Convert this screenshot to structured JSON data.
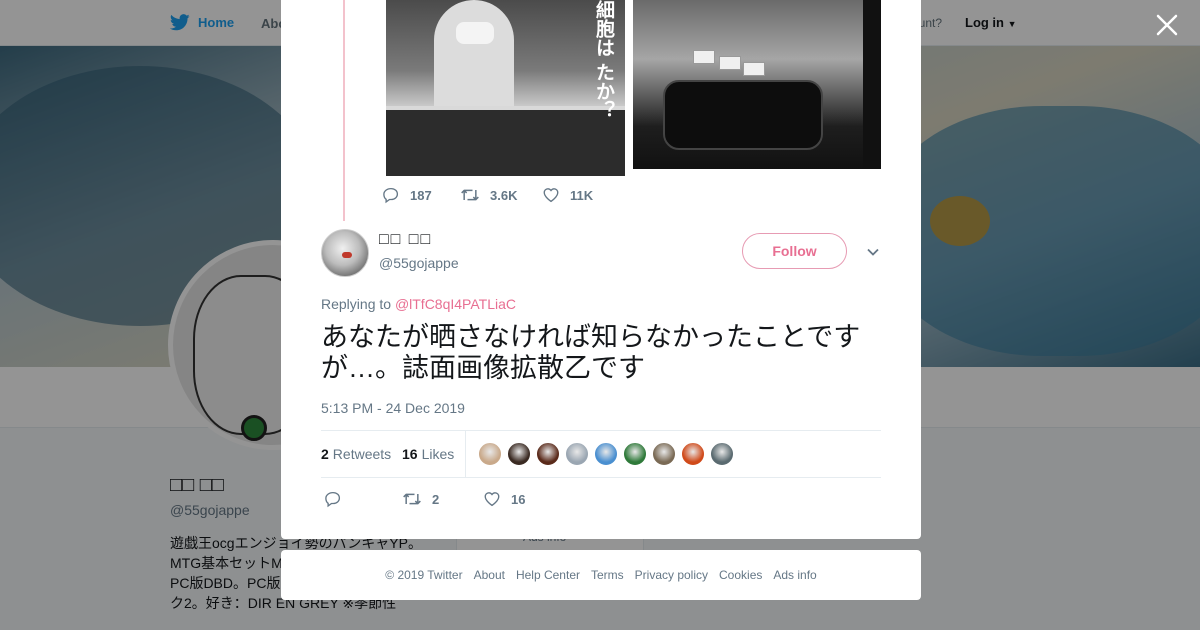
{
  "background_page": {
    "nav": {
      "home_label": "Home",
      "about_label": "Abo",
      "account_prompt": "ccount?",
      "login_label": "Log in"
    },
    "profile": {
      "name": "□□ □□",
      "handle": "@55gojappe",
      "bio": "遊戯王ocgエンジョイ勢のパンキャYP。MTG基本セットM ださい。Steamと い！PC版DBD。PC版+Switch版オーバー クック2。好き：DIR EN GREY ※季節性",
      "ads_info": "Ads info"
    }
  },
  "modal": {
    "parent_tweet": {
      "image_text": "細胞は たか？",
      "actions": {
        "replies": "187",
        "retweets": "3.6K",
        "likes": "11K"
      }
    },
    "reply_tweet": {
      "display_name": "□□ □□",
      "handle": "@55gojappe",
      "follow_label": "Follow",
      "replying_to_prefix": "Replying to",
      "replying_to_handle": "@lTfC8qI4PATLiaC",
      "text": "あなたが晒さなければ知らなかったことですが…。誌面画像拡散乙です",
      "timestamp": "5:13 PM - 24 Dec 2019",
      "stats": {
        "retweets_count": "2",
        "retweets_label": "Retweets",
        "likes_count": "16",
        "likes_label": "Likes"
      },
      "actions": {
        "retweets": "2",
        "likes": "16"
      }
    }
  },
  "footer": {
    "links": [
      "© 2019 Twitter",
      "About",
      "Help Center",
      "Terms",
      "Privacy policy",
      "Cookies",
      "Ads info"
    ]
  },
  "colors": {
    "twitter_blue": "#1da1f2",
    "accent_pink": "#e86f92",
    "thread_line": "#f3c2cc",
    "text_gray": "#657786"
  },
  "likers": [
    {
      "color": "#c9a98a"
    },
    {
      "color": "#3a2a22"
    },
    {
      "color": "#5a2a1a"
    },
    {
      "color": "#9aa6b2"
    },
    {
      "color": "#4a8fd0"
    },
    {
      "color": "#2f7a3a"
    },
    {
      "color": "#7a6a55"
    },
    {
      "color": "#d04a1a"
    },
    {
      "color": "#5a6a70"
    }
  ]
}
